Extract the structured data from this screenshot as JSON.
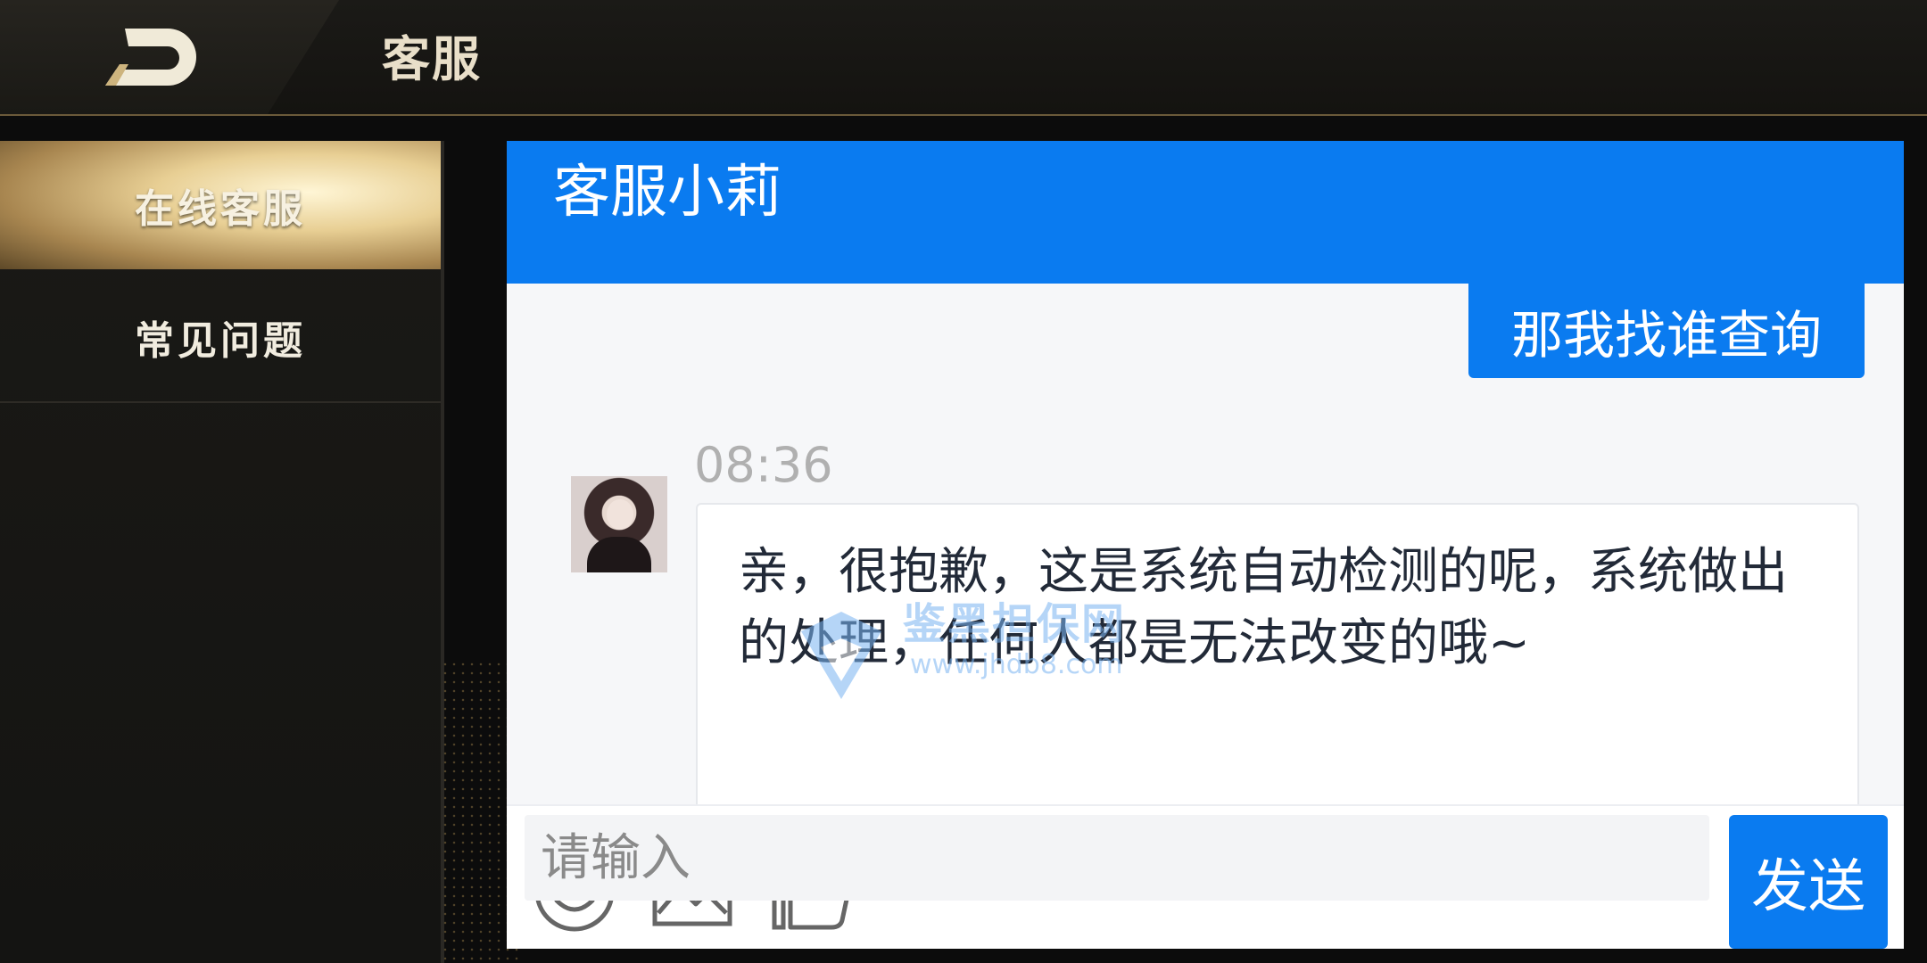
{
  "header": {
    "back_icon": "back-arrow-icon",
    "title": "客服"
  },
  "sidebar": {
    "items": [
      {
        "label": "在线客服",
        "active": true
      },
      {
        "label": "常见问题",
        "active": false
      }
    ]
  },
  "chat": {
    "agent_name": "客服小莉",
    "messages": [
      {
        "from": "user",
        "text": "那我找谁查询"
      },
      {
        "from": "agent",
        "time": "08:36",
        "text": "亲，很抱歉，这是系统自动检测的呢，系统做出的处理，任何人都是无法改变的哦~"
      }
    ],
    "watermark": {
      "title": "鉴黑担保网",
      "url": "www.jhdb8.com"
    },
    "toolbar": [
      "emoji-icon",
      "image-icon",
      "thumbs-up-icon"
    ],
    "input": {
      "placeholder": "请输入",
      "value": ""
    },
    "send_label": "发送"
  },
  "colors": {
    "accent": "#0a7bf0",
    "gold": "#c9a96a",
    "dark": "#141412"
  }
}
